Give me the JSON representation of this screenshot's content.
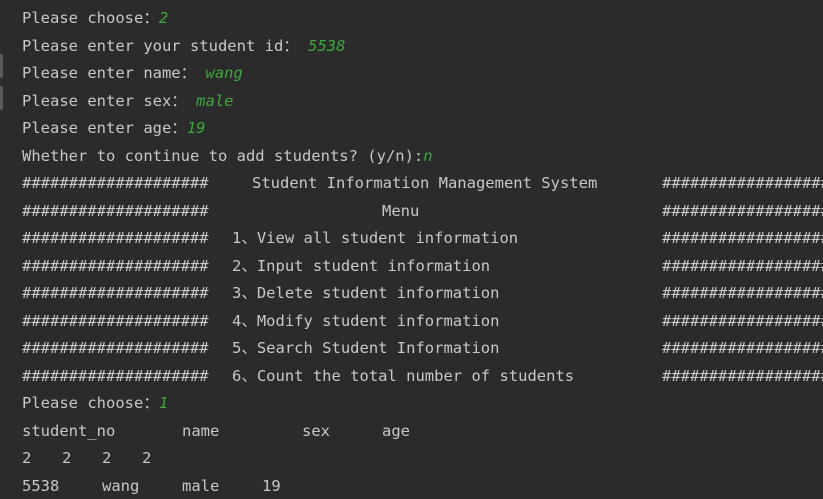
{
  "colors": {
    "background": "#2b2b2b",
    "text": "#c8c8c8",
    "user_input": "#3da83d"
  },
  "add_flow": {
    "choose_prompt": "Please choose：",
    "choose_value": "2",
    "id_prompt": "Please enter your student id： ",
    "id_value": "5538",
    "name_prompt": "Please enter name： ",
    "name_value": "wang",
    "sex_prompt": "Please enter sex： ",
    "sex_value": "male",
    "age_prompt": "Please enter age：",
    "age_value": "19",
    "continue_prompt": "Whether to continue to add students? (y/n):",
    "continue_value": "n"
  },
  "menu": {
    "border": "####################",
    "border_right": "####################",
    "title": "Student Information Management System",
    "subtitle": "Menu",
    "items": [
      "1、View all student information",
      "2、Input student information",
      "3、Delete student information",
      "4、Modify student information",
      "5、Search Student Information",
      "6、Count the total number of students"
    ]
  },
  "view_flow": {
    "choose_prompt": "Please choose：",
    "choose_value": "1",
    "headers": [
      "student_no",
      "name",
      "sex",
      "age"
    ],
    "rows": [
      [
        "2",
        "2",
        "2",
        "2"
      ],
      [
        "5538",
        "wang",
        "male",
        "19"
      ]
    ]
  }
}
